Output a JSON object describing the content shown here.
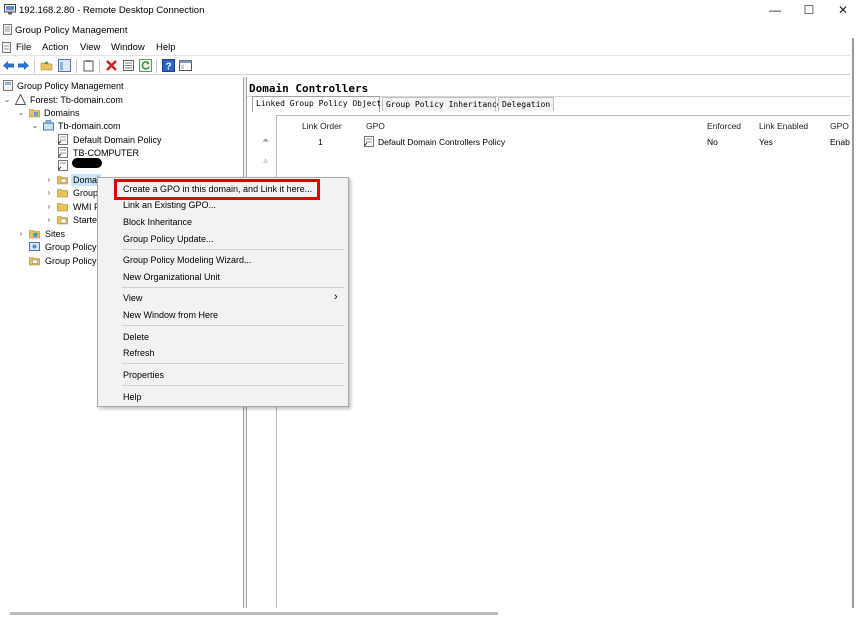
{
  "rdp_window": {
    "title": "192.168.2.80 - Remote Desktop Connection",
    "minimize": "—",
    "maximize": "☐",
    "close": "✕"
  },
  "app": {
    "title": "Group Policy Management"
  },
  "menubar": {
    "items": [
      "File",
      "Action",
      "View",
      "Window",
      "Help"
    ]
  },
  "tree": {
    "root": "Group Policy Management",
    "forest": "Forest: Tb-domain.com",
    "domains": "Domains",
    "domain": "Tb-domain.com",
    "default_domain_policy": "Default Domain Policy",
    "tb_computer": "TB-COMPUTER",
    "domain_controllers": "Domai",
    "group_policy_objects": "Group",
    "wmi_filters": "WMI F",
    "starter_gpos": "Starte",
    "sites": "Sites",
    "group_policy_modeling": "Group Policy",
    "group_policy_results": "Group Policy"
  },
  "right_pane": {
    "header": "Domain Controllers",
    "tabs": [
      "Linked Group Policy Objects",
      "Group Policy Inheritance",
      "Delegation"
    ],
    "columns": {
      "link_order": "Link Order",
      "gpo": "GPO",
      "enforced": "Enforced",
      "link_enabled": "Link Enabled",
      "gpo_status": "GPO"
    },
    "row": {
      "link_order": "1",
      "gpo": "Default Domain Controllers Policy",
      "enforced": "No",
      "link_enabled": "Yes",
      "gpo_status": "Enab"
    }
  },
  "context_menu": {
    "create_gpo": "Create a GPO in this domain, and Link it here...",
    "link_existing": "Link an Existing GPO...",
    "block_inheritance": "Block Inheritance",
    "gp_update": "Group Policy Update...",
    "modeling_wizard": "Group Policy Modeling Wizard...",
    "new_ou": "New Organizational Unit",
    "view": "View",
    "new_window": "New Window from Here",
    "delete": "Delete",
    "refresh": "Refresh",
    "properties": "Properties",
    "help": "Help",
    "submenu_arrow": "›"
  },
  "colors": {
    "highlight": "#e00000",
    "selection": "#cce4f7",
    "menu_bg": "#f2f2f2"
  }
}
